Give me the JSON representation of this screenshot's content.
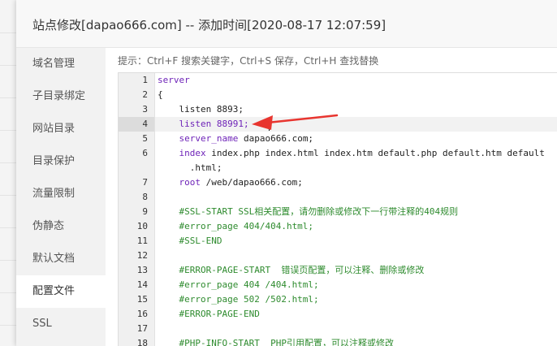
{
  "modal": {
    "title": "站点修改[dapao666.com] -- 添加时间[2020-08-17 12:07:59]"
  },
  "sidebar": {
    "items": [
      {
        "label": "域名管理"
      },
      {
        "label": "子目录绑定"
      },
      {
        "label": "网站目录"
      },
      {
        "label": "目录保护"
      },
      {
        "label": "流量限制"
      },
      {
        "label": "伪静态"
      },
      {
        "label": "默认文档"
      },
      {
        "label": "配置文件"
      },
      {
        "label": "SSL"
      }
    ],
    "active": "配置文件"
  },
  "editor": {
    "hint": "提示：Ctrl+F 搜索关键字，Ctrl+S 保存，Ctrl+H 查找替换",
    "line_numbers": [
      "1",
      "2",
      "3",
      "4",
      "5",
      "6",
      "",
      "7",
      "8",
      "9",
      "10",
      "11",
      "12",
      "13",
      "14",
      "15",
      "16",
      "17",
      "18"
    ],
    "lines": {
      "l1": "server",
      "l2": "{",
      "l3": "    listen 8893;",
      "l4": "    listen 88991;",
      "l5_kw": "    server_name",
      "l5_rest": " dapao666.com;",
      "l6_kw": "    index",
      "l6_rest": " index.php index.html index.htm default.php default.htm default",
      "l6_wrap": "      .html;",
      "l7_kw": "    root",
      "l7_rest": " /web/dapao666.com;",
      "l9": "    #SSL-START SSL相关配置，请勿删除或修改下一行带注释的404规则",
      "l10": "    #error_page 404/404.html;",
      "l11": "    #SSL-END",
      "l13": "    #ERROR-PAGE-START  错误页配置，可以注释、删除或修改",
      "l14": "    #error_page 404 /404.html;",
      "l15": "    #error_page 502 /502.html;",
      "l16": "    #ERROR-PAGE-END",
      "l18": "    #PHP-INFO-START  PHP引用配置，可以注释或修改"
    },
    "active_line": 4
  },
  "colors": {
    "keyword": "#6e23b8",
    "comment": "#2e8b2e",
    "arrow": "#e8352f"
  }
}
